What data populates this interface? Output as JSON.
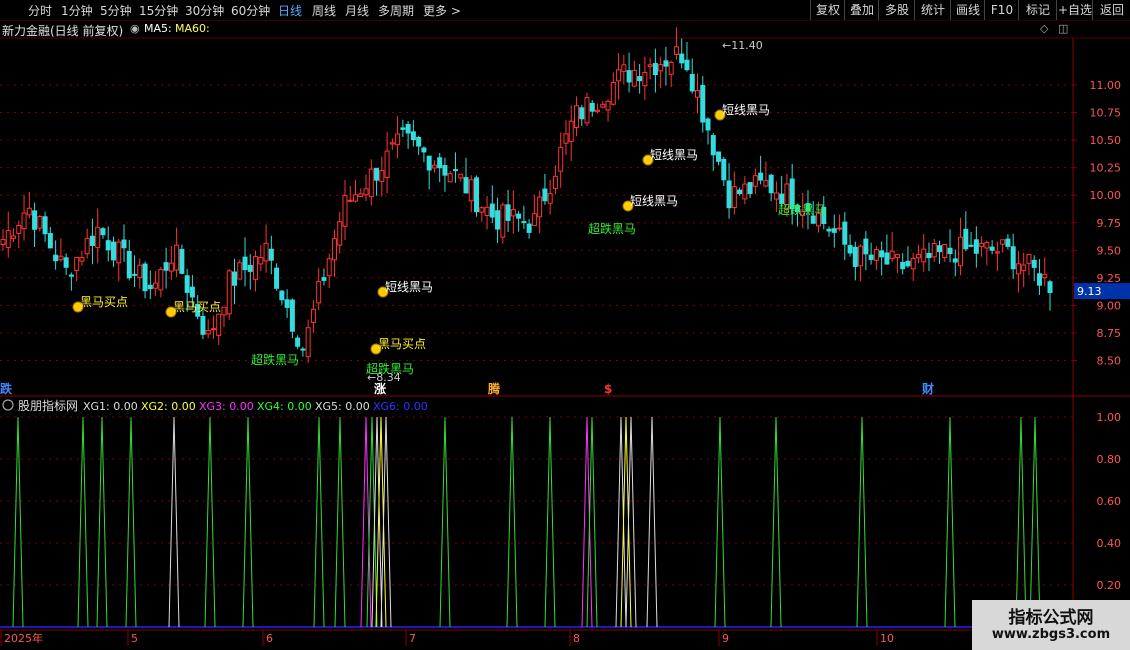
{
  "toolbar": {
    "periods": [
      "分时",
      "1分钟",
      "5分钟",
      "15分钟",
      "30分钟",
      "60分钟",
      "日线",
      "周线",
      "月线",
      "多周期",
      "更多 >"
    ],
    "active_period": "日线",
    "actions": [
      "复权",
      "叠加",
      "多股",
      "统计",
      "画线",
      "F10",
      "标记",
      "+自选",
      "返回"
    ]
  },
  "main_chart": {
    "title": "新力金融(日线 前复权)",
    "ma_labels": [
      "MA5:",
      "MA60:"
    ],
    "price_ticks": [
      "11.00",
      "10.75",
      "10.50",
      "10.25",
      "10.00",
      "9.75",
      "9.50",
      "9.25",
      "9.00",
      "8.75",
      "8.50"
    ],
    "current_price": "9.13",
    "high_label": "11.40",
    "low_label": "8.34",
    "signals": [
      "黑马买点",
      "黑马买点",
      "超跌黑马",
      "短线黑马",
      "黑马买点",
      "超跌黑马",
      "短线黑马",
      "短线黑马",
      "超跌黑马",
      "超跌黑马",
      "短线黑马"
    ],
    "event_markers": [
      "跌",
      "涨",
      "腾",
      "$",
      "财"
    ],
    "colors": {
      "up": "#ff3333",
      "down": "#33dddd",
      "signal_green": "#33ee33",
      "signal_yellow": "#ffee33",
      "axis": "#8b0000",
      "grid": "#800000"
    }
  },
  "indicator": {
    "title": "股朋指标网",
    "values": [
      "XG1: 0.00",
      "XG2: 0.00",
      "XG3: 0.00",
      "XG4: 0.00",
      "XG5: 0.00",
      "XG6: 0.00"
    ],
    "value_colors": [
      "#dddddd",
      "#ffff33",
      "#ff33ff",
      "#33ff33",
      "#dddddd",
      "#3333ff"
    ],
    "ticks": [
      "1.00",
      "0.80",
      "0.60",
      "0.40",
      "0.20"
    ]
  },
  "time_axis": {
    "labels": [
      "2025年",
      "5",
      "6",
      "7",
      "8",
      "9",
      "10"
    ]
  },
  "watermark": {
    "line1": "指标公式网",
    "line2": "www.zbgs3.com"
  }
}
